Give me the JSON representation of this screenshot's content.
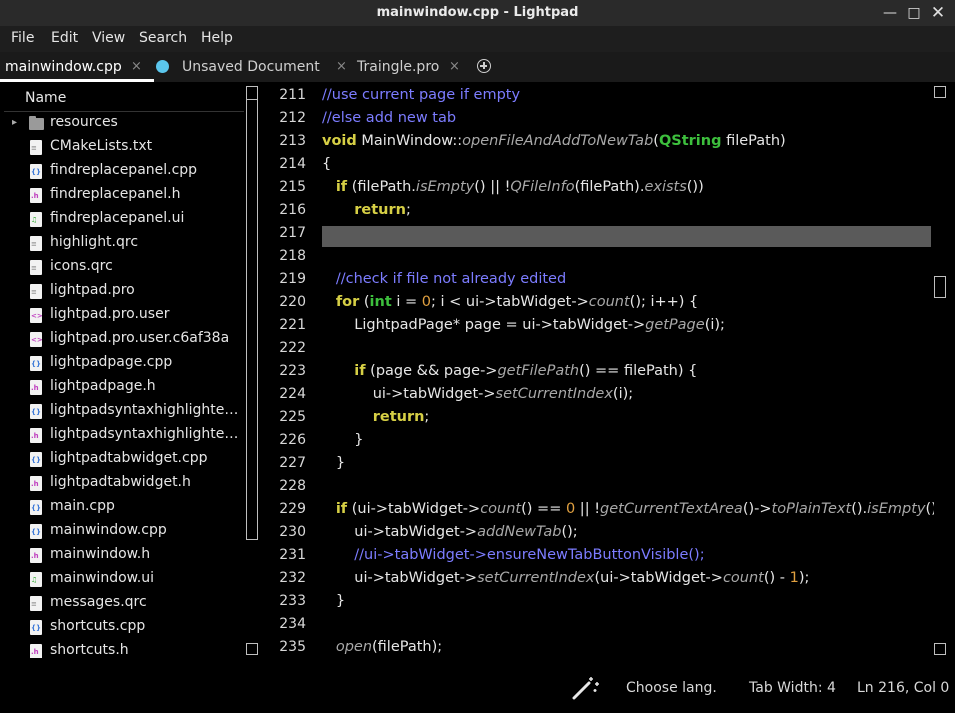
{
  "window": {
    "title": "mainwindow.cpp - Lightpad"
  },
  "menu": [
    "File",
    "Edit",
    "View",
    "Search",
    "Help"
  ],
  "tabs": [
    {
      "label": "mainwindow.cpp",
      "active": true,
      "modified": false
    },
    {
      "label": "Unsaved Document",
      "active": false,
      "modified": true
    },
    {
      "label": "Traingle.pro",
      "active": false,
      "modified": false
    }
  ],
  "tab_close_glyph": "×",
  "tree": {
    "header": "Name",
    "items": [
      {
        "name": "resources",
        "kind": "folder"
      },
      {
        "name": "CMakeLists.txt",
        "kind": "text"
      },
      {
        "name": "findreplacepanel.cpp",
        "kind": "cpp"
      },
      {
        "name": "findreplacepanel.h",
        "kind": "h"
      },
      {
        "name": "findreplacepanel.ui",
        "kind": "ui"
      },
      {
        "name": "highlight.qrc",
        "kind": "text"
      },
      {
        "name": "icons.qrc",
        "kind": "text"
      },
      {
        "name": "lightpad.pro",
        "kind": "text"
      },
      {
        "name": "lightpad.pro.user",
        "kind": "xml"
      },
      {
        "name": "lightpad.pro.user.c6af38a",
        "kind": "xml"
      },
      {
        "name": "lightpadpage.cpp",
        "kind": "cpp"
      },
      {
        "name": "lightpadpage.h",
        "kind": "h"
      },
      {
        "name": "lightpadsyntaxhighlighte…",
        "kind": "cpp"
      },
      {
        "name": "lightpadsyntaxhighlighte…",
        "kind": "h"
      },
      {
        "name": "lightpadtabwidget.cpp",
        "kind": "cpp"
      },
      {
        "name": "lightpadtabwidget.h",
        "kind": "h"
      },
      {
        "name": "main.cpp",
        "kind": "cpp"
      },
      {
        "name": "mainwindow.cpp",
        "kind": "cpp"
      },
      {
        "name": "mainwindow.h",
        "kind": "h"
      },
      {
        "name": "mainwindow.ui",
        "kind": "ui"
      },
      {
        "name": "messages.qrc",
        "kind": "text"
      },
      {
        "name": "shortcuts.cpp",
        "kind": "cpp"
      },
      {
        "name": "shortcuts.h",
        "kind": "h"
      }
    ]
  },
  "editor": {
    "current_line": 217,
    "lines": [
      {
        "n": "211",
        "tokens": [
          [
            "cmt",
            "//use current page if empty"
          ]
        ]
      },
      {
        "n": "212",
        "tokens": [
          [
            "cmt",
            "//else add new tab"
          ]
        ]
      },
      {
        "n": "213",
        "tokens": [
          [
            "kw",
            "void"
          ],
          [
            "",
            " MainWindow::"
          ],
          [
            "fn",
            "openFileAndAddToNewTab"
          ],
          [
            "",
            "("
          ],
          [
            "type",
            "QString"
          ],
          [
            "",
            " filePath)"
          ]
        ]
      },
      {
        "n": "214",
        "tokens": [
          [
            "",
            "{"
          ]
        ]
      },
      {
        "n": "215",
        "tokens": [
          [
            "",
            "   "
          ],
          [
            "kw",
            "if"
          ],
          [
            "",
            " (filePath."
          ],
          [
            "fn",
            "isEmpty"
          ],
          [
            "",
            "() || !"
          ],
          [
            "fn",
            "QFileInfo"
          ],
          [
            "",
            "(filePath)."
          ],
          [
            "fn",
            "exists"
          ],
          [
            "",
            "())"
          ]
        ]
      },
      {
        "n": "216",
        "tokens": [
          [
            "",
            "       "
          ],
          [
            "kw",
            "return"
          ],
          [
            "",
            ";"
          ]
        ]
      },
      {
        "n": "217",
        "tokens": []
      },
      {
        "n": "218",
        "tokens": []
      },
      {
        "n": "219",
        "tokens": [
          [
            "",
            "   "
          ],
          [
            "cmt",
            "//check if file not already edited"
          ]
        ]
      },
      {
        "n": "220",
        "tokens": [
          [
            "",
            "   "
          ],
          [
            "kw",
            "for"
          ],
          [
            "",
            " ("
          ],
          [
            "type",
            "int"
          ],
          [
            "",
            " i = "
          ],
          [
            "num",
            "0"
          ],
          [
            "",
            "; i < ui->tabWidget->"
          ],
          [
            "fn",
            "count"
          ],
          [
            "",
            "(); i++) {"
          ]
        ]
      },
      {
        "n": "221",
        "tokens": [
          [
            "",
            "       LightpadPage* page = ui->tabWidget->"
          ],
          [
            "fn",
            "getPage"
          ],
          [
            "",
            "(i);"
          ]
        ]
      },
      {
        "n": "222",
        "tokens": []
      },
      {
        "n": "223",
        "tokens": [
          [
            "",
            "       "
          ],
          [
            "kw",
            "if"
          ],
          [
            "",
            " (page && page->"
          ],
          [
            "fn",
            "getFilePath"
          ],
          [
            "",
            "() == filePath) {"
          ]
        ]
      },
      {
        "n": "224",
        "tokens": [
          [
            "",
            "           ui->tabWidget->"
          ],
          [
            "fn",
            "setCurrentIndex"
          ],
          [
            "",
            "(i);"
          ]
        ]
      },
      {
        "n": "225",
        "tokens": [
          [
            "",
            "           "
          ],
          [
            "kw",
            "return"
          ],
          [
            "",
            ";"
          ]
        ]
      },
      {
        "n": "226",
        "tokens": [
          [
            "",
            "       }"
          ]
        ]
      },
      {
        "n": "227",
        "tokens": [
          [
            "",
            "   }"
          ]
        ]
      },
      {
        "n": "228",
        "tokens": []
      },
      {
        "n": "229",
        "tokens": [
          [
            "",
            "   "
          ],
          [
            "kw",
            "if"
          ],
          [
            "",
            " (ui->tabWidget->"
          ],
          [
            "fn",
            "count"
          ],
          [
            "",
            "() == "
          ],
          [
            "num",
            "0"
          ],
          [
            "",
            " || !"
          ],
          [
            "fn",
            "getCurrentTextArea"
          ],
          [
            "",
            "()->"
          ],
          [
            "fn",
            "toPlainText"
          ],
          [
            "",
            "()."
          ],
          [
            "fn",
            "isEmpty"
          ],
          [
            "",
            "()) {"
          ]
        ]
      },
      {
        "n": "230",
        "tokens": [
          [
            "",
            "       ui->tabWidget->"
          ],
          [
            "fn",
            "addNewTab"
          ],
          [
            "",
            "();"
          ]
        ]
      },
      {
        "n": "231",
        "tokens": [
          [
            "",
            "       "
          ],
          [
            "cmt",
            "//ui->tabWidget->ensureNewTabButtonVisible();"
          ]
        ]
      },
      {
        "n": "232",
        "tokens": [
          [
            "",
            "       ui->tabWidget->"
          ],
          [
            "fn",
            "setCurrentIndex"
          ],
          [
            "",
            "(ui->tabWidget->"
          ],
          [
            "fn",
            "count"
          ],
          [
            "",
            "() - "
          ],
          [
            "num",
            "1"
          ],
          [
            "",
            ");"
          ]
        ]
      },
      {
        "n": "233",
        "tokens": [
          [
            "",
            "   }"
          ]
        ]
      },
      {
        "n": "234",
        "tokens": []
      },
      {
        "n": "235",
        "tokens": [
          [
            "",
            "   "
          ],
          [
            "fn",
            "open"
          ],
          [
            "",
            "(filePath);"
          ]
        ]
      }
    ]
  },
  "status": {
    "language": "Choose lang.",
    "tab_width": "Tab Width: 4",
    "position": "Ln 216, Col 0"
  },
  "icons": {
    "minimize": "minimize-icon",
    "maximize": "maximize-icon",
    "close": "close-icon",
    "add_tab": "plus-circle-icon",
    "wand": "magic-wand-icon"
  },
  "colors": {
    "comment": "#7c7cff",
    "keyword": "#d6cf45",
    "type": "#3dbf3d",
    "function": "#a8a8a8",
    "number": "#e0a040",
    "current_line": "#5a5a5a",
    "modified_dot": "#5bc6ec"
  }
}
